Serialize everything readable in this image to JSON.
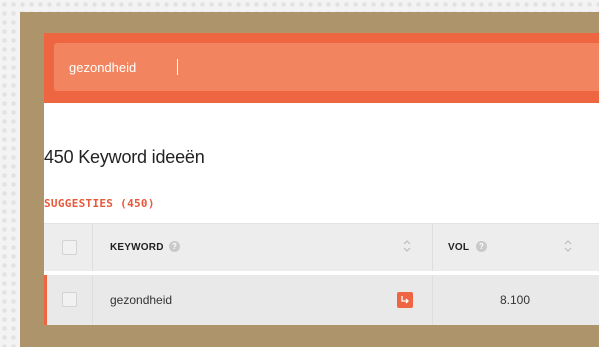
{
  "search": {
    "value": "gezondheid"
  },
  "results": {
    "title": "450 Keyword ideeën"
  },
  "tabs": [
    {
      "label": "SUGGESTIES (450)"
    }
  ],
  "table": {
    "columns": [
      {
        "label": "KEYWORD",
        "help_icon": "help-icon",
        "sort_icon": "sort-icon"
      },
      {
        "label": "VOL",
        "help_icon": "help-icon",
        "sort_icon": "sort-icon"
      }
    ],
    "rows": [
      {
        "keyword": "gezondheid",
        "action_icon": "arrow-turn-icon",
        "volume": "8.100"
      }
    ]
  },
  "colors": {
    "accent": "#ee6641",
    "search_field": "#f2845f",
    "frame": "#ad946b",
    "header_bg": "#ededed",
    "row_bg": "#e9e9e9"
  }
}
